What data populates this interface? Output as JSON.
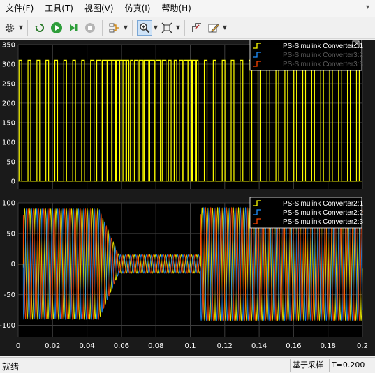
{
  "menu": [
    "文件(F)",
    "工具(T)",
    "视图(V)",
    "仿真(I)",
    "帮助(H)"
  ],
  "toolbar_icons": [
    "settings-icon",
    "rewind-icon",
    "run-icon",
    "step-forward-icon",
    "stop-icon",
    "signal-select-icon",
    "zoom-icon",
    "fit-to-view-icon",
    "cursor-measure-icon",
    "style-edit-icon"
  ],
  "colors": {
    "figure_bg": "#1a1a1a",
    "axes_bg": "#000000",
    "grid": "#3c3c3c",
    "phase1": "#ffff00",
    "phase2": "#1e90ff",
    "phase3": "#ff4500"
  },
  "status": {
    "left": "就绪",
    "mode": "基于采样",
    "time": "T=0.200"
  },
  "chart_data": [
    {
      "type": "line",
      "ylim": [
        -20,
        350
      ],
      "yticks": [
        "350",
        "300",
        "250",
        "200",
        "150",
        "100",
        "50",
        "0"
      ],
      "xlim": [
        0,
        0.2
      ],
      "grid": true,
      "legend_position": "top-right",
      "series": [
        {
          "name": "PS-Simulink Converter3:1",
          "color": "#ffff00",
          "low": 0,
          "high": 310,
          "shape": "pwm-square"
        },
        {
          "name": "PS-Simulink Converter3:2",
          "color": "#1e90ff",
          "low": 0,
          "high": 310
        },
        {
          "name": "PS-Simulink Converter3:3",
          "color": "#ff4500",
          "low": 0,
          "high": 310
        }
      ]
    },
    {
      "type": "line",
      "ylim": [
        -120,
        100
      ],
      "yticks": [
        "100",
        "50",
        "0",
        "-50",
        "-100"
      ],
      "xlim": [
        0,
        0.2
      ],
      "xticks": [
        "0",
        "0.02",
        "0.04",
        "0.06",
        "0.08",
        "0.1",
        "0.12",
        "0.14",
        "0.16",
        "0.18",
        "0.2"
      ],
      "grid": true,
      "legend_position": "top-right",
      "amplitude_segments": [
        {
          "t0": 0.003,
          "t1": 0.047,
          "amp": 90
        },
        {
          "t0": 0.047,
          "t1": 0.059,
          "amp": 90,
          "amp_end": 12
        },
        {
          "t0": 0.059,
          "t1": 0.106,
          "amp": 15
        },
        {
          "t0": 0.106,
          "t1": 0.2,
          "amp": 92
        }
      ],
      "series": [
        {
          "name": "PS-Simulink Converter2:1",
          "color": "#ffff00"
        },
        {
          "name": "PS-Simulink Converter2:2",
          "color": "#1e90ff"
        },
        {
          "name": "PS-Simulink Converter2:3",
          "color": "#ff4500"
        }
      ]
    }
  ]
}
